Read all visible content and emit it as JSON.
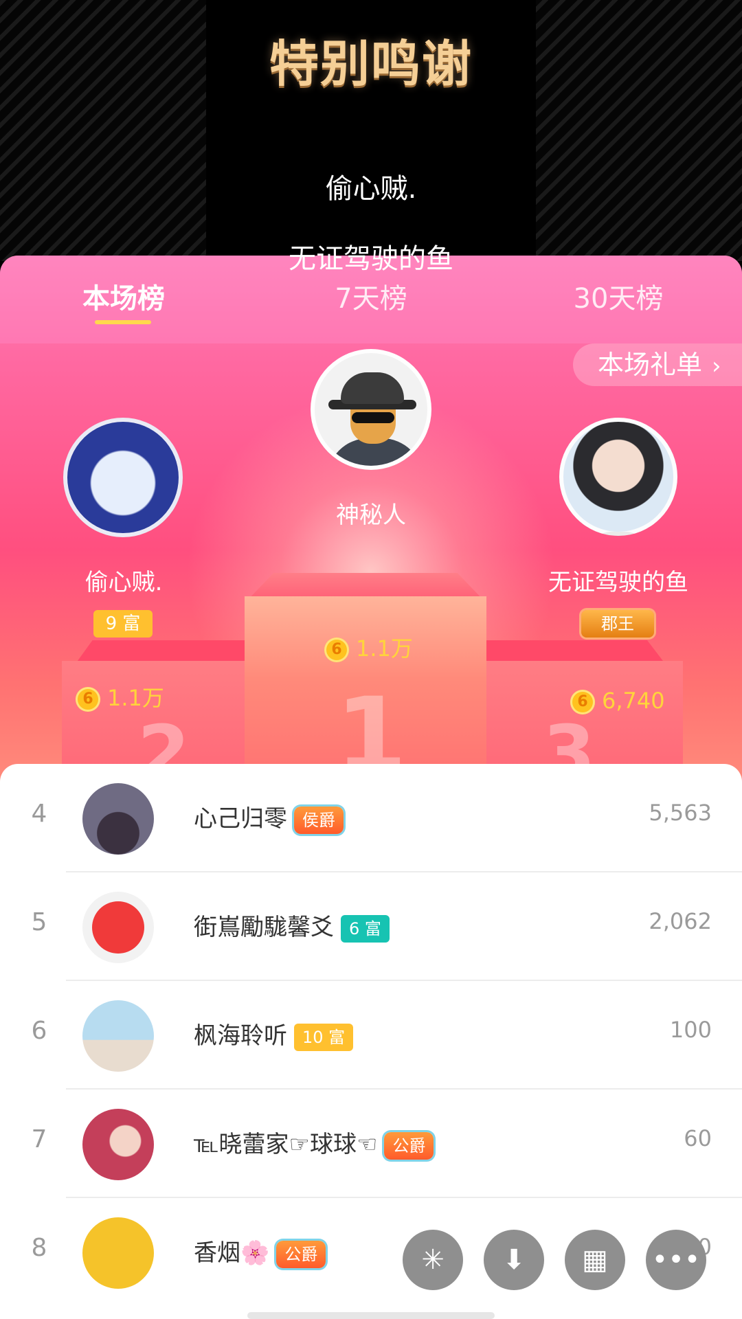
{
  "header": {
    "title": "特别鸣谢",
    "credits": [
      "偷心贼.",
      "无证驾驶的鱼"
    ]
  },
  "tabs": [
    {
      "label": "本场榜",
      "active": true
    },
    {
      "label": "7天榜",
      "active": false
    },
    {
      "label": "30天榜",
      "active": false
    }
  ],
  "gift_list_link": "本场礼单",
  "podium": {
    "first": {
      "name": "神秘人",
      "score": "1.1万",
      "rank": "1"
    },
    "second": {
      "name": "偷心贼.",
      "badge": "9 富",
      "score": "1.1万",
      "rank": "2"
    },
    "third": {
      "name": "无证驾驶的鱼",
      "badge": "郡王",
      "score": "6,740",
      "rank": "3"
    }
  },
  "coin_glyph": "6",
  "list": [
    {
      "rank": "4",
      "name": "心己归零",
      "tag": "侯爵",
      "score": "5,563"
    },
    {
      "rank": "5",
      "name": "衘嶌勵駹馨爻",
      "tag": "6 富",
      "score": "2,062"
    },
    {
      "rank": "6",
      "name": "枫海聆听",
      "tag": "10 富",
      "score": "100"
    },
    {
      "rank": "7",
      "name": "℡晓蕾家☞球球☜",
      "tag": "公爵",
      "score": "60"
    },
    {
      "rank": "8",
      "name": "香烟🌸",
      "tag": "公爵",
      "score": "50"
    }
  ],
  "fab_icons": [
    "share-icon",
    "download-icon",
    "grid-icon",
    "more-icon"
  ],
  "colors": {
    "panel_pink": "#ff5b8b",
    "tab_underline": "#ffd84d",
    "coin": "#ffd43b"
  }
}
